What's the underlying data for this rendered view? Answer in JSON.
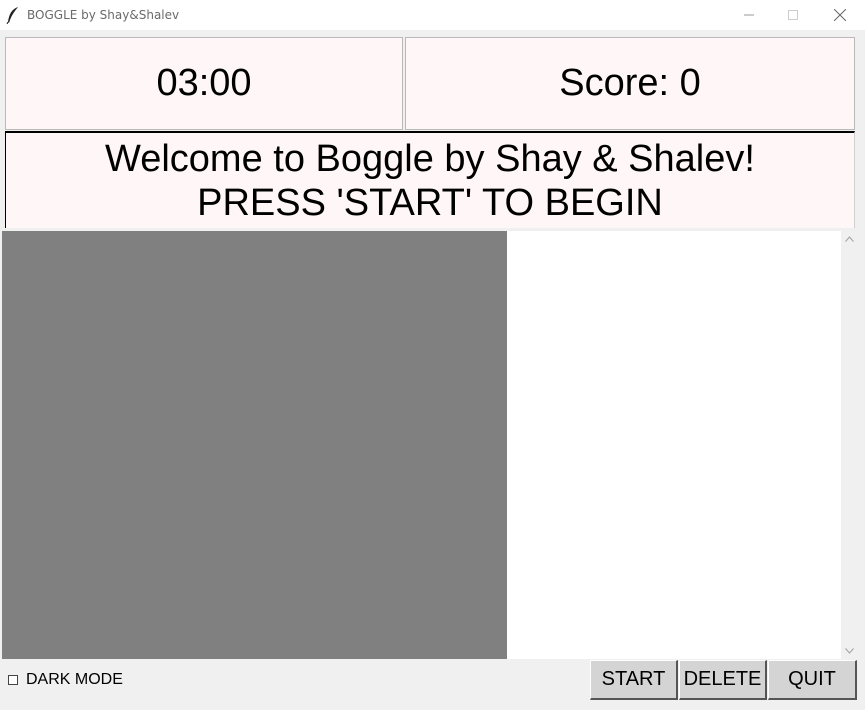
{
  "window": {
    "title": "BOGGLE by Shay&Shalev",
    "icon": "feather-icon",
    "controls": [
      "minimize-icon",
      "maximize-icon",
      "close-icon"
    ]
  },
  "timer": {
    "value": "03:00"
  },
  "score": {
    "label": "Score: 0"
  },
  "message": {
    "line1": "Welcome to Boggle by Shay & Shalev!",
    "line2": "PRESS 'START' TO BEGIN"
  },
  "options": {
    "dark_mode_label": "DARK MODE",
    "dark_mode_checked": false
  },
  "buttons": {
    "start": "START",
    "delete": "DELETE",
    "quit": "QUIT"
  },
  "colors": {
    "panel_background": "#fff7f7",
    "board_background": "#808080",
    "words_background": "#ffffff",
    "button_background": "#d4d4d4"
  }
}
